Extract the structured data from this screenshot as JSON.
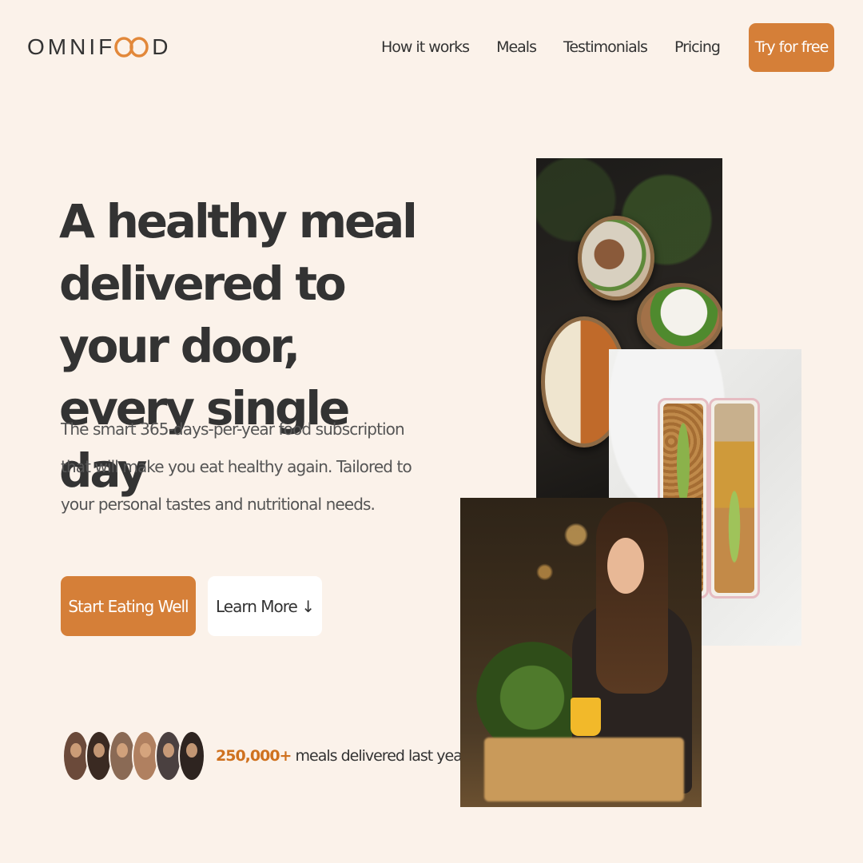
{
  "brand": {
    "logo_left": "OMNIF",
    "logo_right": "D",
    "logo_mark": "infinity-oo-icon",
    "accent_color": "#e67e22"
  },
  "nav": {
    "links": [
      "How it works",
      "Meals",
      "Testimonials",
      "Pricing"
    ],
    "cta_label": "Try for free"
  },
  "hero": {
    "title": "A healthy meal delivered to your door, every single day",
    "description": "The smart 365-days-per-year food subscription that will make you eat healthy again. Tailored to your personal tastes and nutritional needs.",
    "primary_button": "Start Eating Well",
    "secondary_button": "Learn More ↓"
  },
  "delivered": {
    "count": "250,000+",
    "text": " meals delivered last year!"
  },
  "colors": {
    "background": "#fdf2e9",
    "accent": "#e67e22",
    "text": "#333333"
  }
}
